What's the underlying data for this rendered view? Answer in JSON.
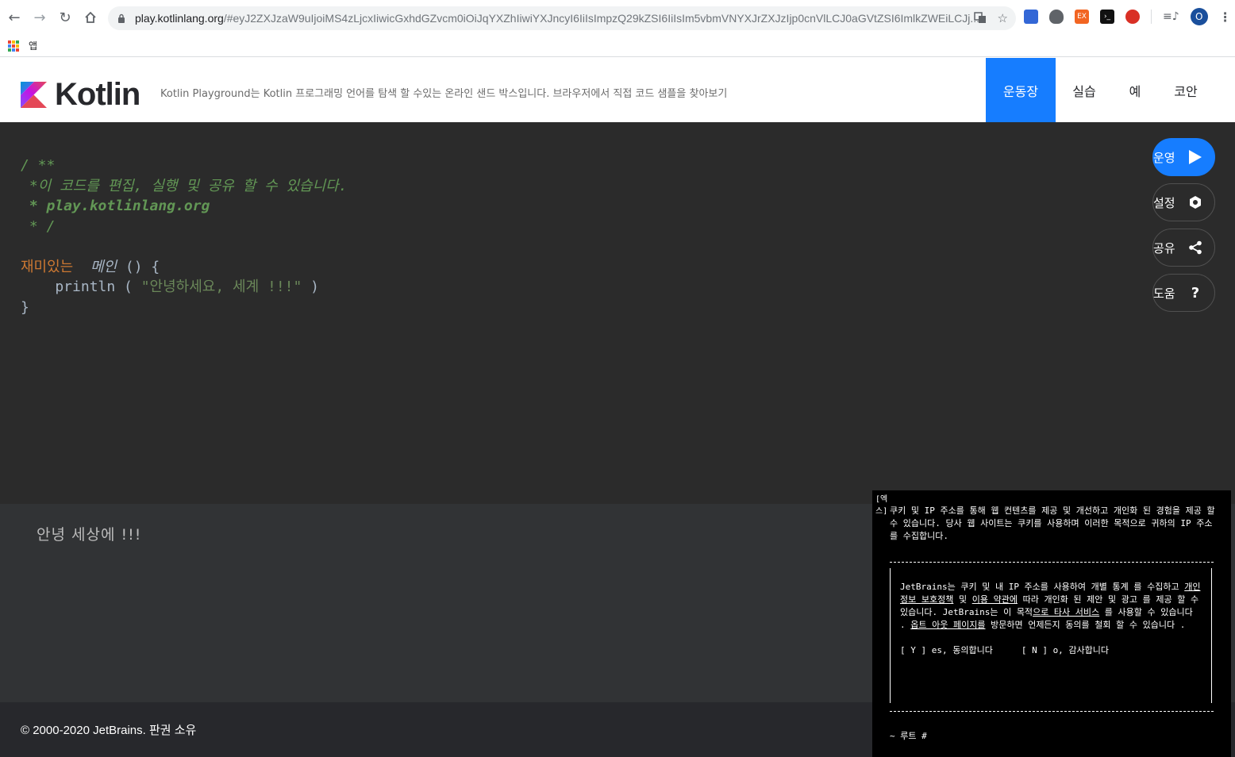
{
  "browser": {
    "url_host": "play.kotlinlang.org",
    "url_rest": "/#eyJ2ZXJzaW9uIjoiMS4zLjcxIiwicGxhdGZvcm0iOiJqYXZhIiwiYXJncyI6IiIsImpzQ29kZSI6IiIsIm5vbmVNYXJrZXJzIjp0cnVlLCJ0aGVtZSI6ImlkZWEiLCJj...",
    "bookmark_label": "앱",
    "profile_initial": "O",
    "ext_badge": "EX"
  },
  "header": {
    "logo_text": "Kotlin",
    "tagline": "Kotlin Playground는 Kotlin 프로그래밍 언어를 탐색 할 수있는 온라인 샌드 박스입니다. 브라우저에서 직접 코드 샘플을 찾아보기",
    "nav": [
      "운동장",
      "실습",
      "예",
      "코안"
    ]
  },
  "editor": {
    "lines": [
      "/ **",
      " *이 코드를 편집, 실행 및 공유 할 수 있습니다.",
      " * play.kotlinlang.org",
      " * /",
      "",
      "재미있는",
      "메인",
      " () {",
      "    println ( ",
      "\"안녕하세요, 세계 !!!\"",
      " )",
      "}"
    ],
    "buttons": {
      "run": "운영",
      "settings": "설정",
      "share": "공유",
      "help": "도움"
    }
  },
  "output": {
    "text": "안녕 세상에 !!!"
  },
  "footer": {
    "copyright": "© 2000-2020 JetBrains. 판권 소유"
  },
  "cookie": {
    "close": "[엑스]",
    "intro": "쿠키 및 IP 주소를 통해 웹 컨텐츠를 제공 및 개선하고 개인화 된 경험을 제공 할 수 있습니다. 당사 웹 사이트는 쿠키를 사용하며 이러한 목적으로 귀하의 IP 주소를 수집합니다.",
    "body_1": "JetBrains는 쿠키 및 내 IP 주소를 사용하여 개별 통계 를 수집하고 ",
    "link_privacy": "개인 정보 보호정책",
    "body_2": " 및 ",
    "link_terms": "이용 약관에",
    "body_3": " 따라 개인화 된 제안 및 광고 를 제공 할 수 있습니다. JetBrains는 이 목적",
    "link_thirdparty": "으로 타사 서비스",
    "body_4": " 를 사용할 수 있습니다 . ",
    "link_optout": "옵트 아웃 페이지를",
    "body_5": " 방문하면 언제든지 동의를 철회 할 수 있습니다 .",
    "yes": "[ Y ] es, 동의합니다",
    "no": "[ N ] o, 감사합니다",
    "prompt": "~ 루트 #"
  }
}
